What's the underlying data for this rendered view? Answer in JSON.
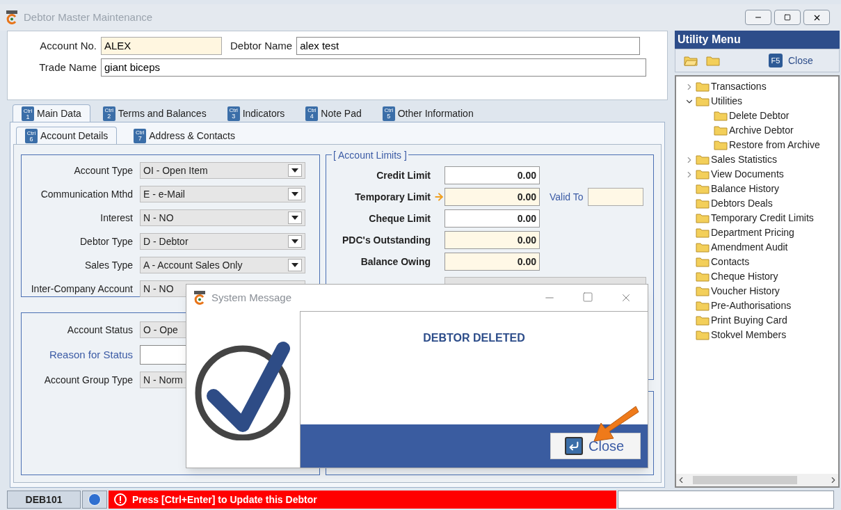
{
  "window": {
    "title": "Debtor Master Maintenance"
  },
  "header": {
    "fields": [
      {
        "label": "Account No.",
        "value": "ALEX",
        "kind": "readonly"
      },
      {
        "label": "Debtor Name",
        "value": "alex test",
        "kind": "edit"
      },
      {
        "label": "Trade Name",
        "value": "giant biceps",
        "kind": "edit"
      }
    ]
  },
  "tabs": [
    {
      "key_label": "Ctrl",
      "key_number": "1",
      "label": "Main Data",
      "selected": true
    },
    {
      "key_label": "Ctrl",
      "key_number": "2",
      "label": "Terms and Balances",
      "selected": false
    },
    {
      "key_label": "Ctrl",
      "key_number": "3",
      "label": "Indicators",
      "selected": false
    },
    {
      "key_label": "Ctrl",
      "key_number": "4",
      "label": "Note Pad",
      "selected": false
    },
    {
      "key_label": "Ctrl",
      "key_number": "5",
      "label": "Other Information",
      "selected": false
    }
  ],
  "subtabs": [
    {
      "key_label": "Ctrl",
      "key_number": "6",
      "label": "Account Details",
      "selected": true
    },
    {
      "key_label": "Ctrl",
      "key_number": "7",
      "label": "Address & Contacts",
      "selected": false
    }
  ],
  "account_settings": [
    {
      "label": "Account Type",
      "value": "OI - Open Item"
    },
    {
      "label": "Communication Mthd",
      "value": "E - e-Mail"
    },
    {
      "label": "Interest",
      "value": "N - NO"
    },
    {
      "label": "Debtor Type",
      "value": "D - Debtor"
    },
    {
      "label": "Sales Type",
      "value": "A - Account Sales Only"
    },
    {
      "label": "Inter-Company Account",
      "value": "N - NO"
    }
  ],
  "status_fields": [
    {
      "label": "Account Status",
      "value": "O - Ope",
      "kind": "combo",
      "highlight": false
    },
    {
      "label": "Reason for Status",
      "kind": "text",
      "highlight": true
    },
    {
      "label": "Account Group Type",
      "value": "N - Norm",
      "kind": "combo",
      "highlight": false
    }
  ],
  "account_limits": {
    "title": "[ Account Limits ]",
    "rows": [
      {
        "label": "Credit Limit",
        "value": "0.00",
        "readonly": false,
        "arrow": false
      },
      {
        "label": "Temporary Limit",
        "value": "0.00",
        "readonly": true,
        "arrow": true
      },
      {
        "label": "Cheque Limit",
        "value": "0.00",
        "readonly": false,
        "arrow": false
      },
      {
        "label": "PDC's Outstanding",
        "value": "0.00",
        "readonly": true,
        "arrow": false
      },
      {
        "label": "Balance Owing",
        "value": "0.00",
        "readonly": true,
        "arrow": false
      }
    ],
    "valid_to": {
      "label": "Valid To"
    }
  },
  "utility_menu": {
    "title": "Utility Menu",
    "close_key": "F5",
    "close_label": "Close",
    "tree": [
      {
        "label": "Transactions",
        "kind": "group",
        "expanded": false
      },
      {
        "label": "Utilities",
        "kind": "group",
        "expanded": true,
        "children": [
          {
            "label": "Delete Debtor"
          },
          {
            "label": "Archive Debtor"
          },
          {
            "label": "Restore from Archive"
          }
        ]
      },
      {
        "label": "Sales Statistics",
        "kind": "group",
        "expanded": false
      },
      {
        "label": "View Documents",
        "kind": "group",
        "expanded": false
      },
      {
        "label": "Balance History",
        "kind": "item"
      },
      {
        "label": "Debtors Deals",
        "kind": "item"
      },
      {
        "label": "Temporary Credit Limits",
        "kind": "item"
      },
      {
        "label": "Department Pricing",
        "kind": "item"
      },
      {
        "label": "Amendment Audit",
        "kind": "item"
      },
      {
        "label": "Contacts",
        "kind": "item"
      },
      {
        "label": "Cheque History",
        "kind": "item"
      },
      {
        "label": "Voucher History",
        "kind": "item"
      },
      {
        "label": "Pre-Authorisations",
        "kind": "item"
      },
      {
        "label": "Print Buying Card",
        "kind": "item"
      },
      {
        "label": "Stokvel Members",
        "kind": "item"
      }
    ]
  },
  "dialog": {
    "title": "System Message",
    "message": "DEBTOR DELETED",
    "button": "Close"
  },
  "status_bar": {
    "code": "DEB101",
    "message": "Press [Ctrl+Enter] to Update this Debtor"
  }
}
